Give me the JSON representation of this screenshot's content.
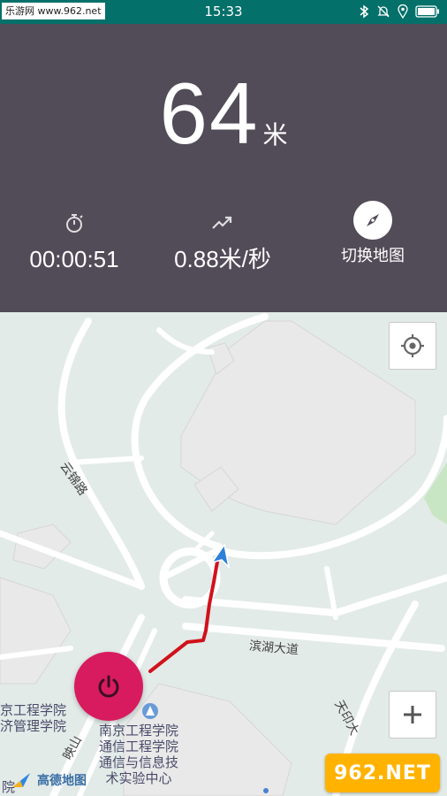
{
  "status_bar": {
    "watermark": "乐游网 www.962.net",
    "time": "15:33",
    "icons": [
      "bluetooth-icon",
      "bell-muted-icon",
      "location-icon",
      "battery-icon"
    ]
  },
  "stats": {
    "distance_value": "64",
    "distance_unit": "米",
    "duration": "00:00:51",
    "speed": "0.88米/秒",
    "switch_map_label": "切换地图",
    "icons": [
      "stopwatch-icon",
      "trend-icon",
      "compass-icon"
    ]
  },
  "map": {
    "road_labels": [
      "云锦路",
      "滨湖大道",
      "映山",
      "天印大"
    ],
    "poi_left_line1": "京工程学院",
    "poi_left_line2": "济管理学院",
    "poi_main_line1": "南京工程学院",
    "poi_main_line2": "通信工程学院",
    "poi_main_line3": "通信与信息技",
    "poi_main_line4": "术实验中心",
    "poi_small": "院",
    "logo_text": "高德地图",
    "brand_badge": "962.NET",
    "brand_sub": "乐游网"
  },
  "colors": {
    "status_bar": "#04706a",
    "panel": "#524b58",
    "track": "#d0121b",
    "power_button": "#d81b5e"
  }
}
